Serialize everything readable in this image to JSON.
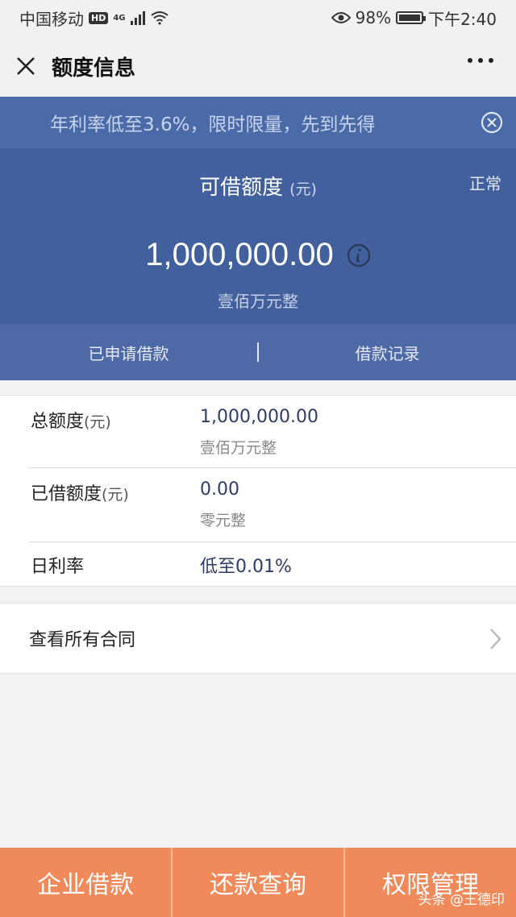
{
  "status_bar": {
    "carrier": "中国移动",
    "hd": "HD",
    "network": "4G",
    "battery_percent": "98%",
    "battery_level": 0.98,
    "time": "下午2:40"
  },
  "nav": {
    "title": "额度信息"
  },
  "promo": {
    "text": "年利率低至3.6%，限时限量，先到先得"
  },
  "hero": {
    "label": "可借额度",
    "unit": "(元)",
    "status": "正常",
    "amount": "1,000,000.00",
    "amount_words": "壹佰万元整",
    "tabs": [
      "已申请借款",
      "借款记录"
    ]
  },
  "details": {
    "total_label": "总额度",
    "total_unit": "(元)",
    "total_value": "1,000,000.00",
    "total_words": "壹佰万元整",
    "borrowed_label": "已借额度",
    "borrowed_unit": "(元)",
    "borrowed_value": "0.00",
    "borrowed_words": "零元整",
    "rate_label": "日利率",
    "rate_value": "低至0.01%"
  },
  "contracts": {
    "label": "查看所有合同"
  },
  "bottom_bar": {
    "buttons": [
      "企业借款",
      "还款查询",
      "权限管理"
    ]
  },
  "watermark": "头条 @王德印",
  "colors": {
    "hero_bg": "#42609e",
    "promo_bg": "#4b6aa8",
    "bottom_bar": "#f08a5a"
  }
}
